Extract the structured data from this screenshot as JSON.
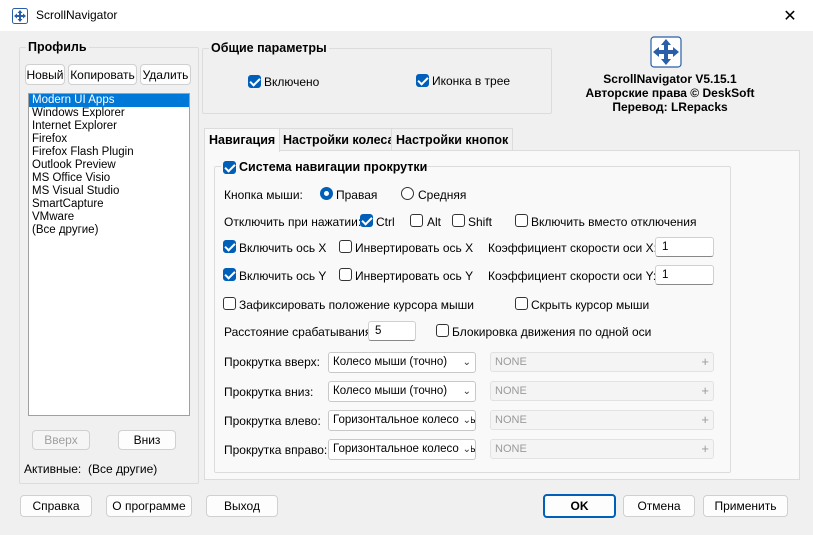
{
  "window": {
    "title": "ScrollNavigator"
  },
  "profile": {
    "group_title": "Профиль",
    "new_label": "Новый",
    "copy_label": "Копировать",
    "delete_label": "Удалить",
    "items": [
      "Modern UI Apps",
      "Windows Explorer",
      "Internet Explorer",
      "Firefox",
      "Firefox Flash Plugin",
      "Outlook Preview",
      "MS Office Visio",
      "MS Visual Studio",
      "SmartCapture",
      "VMware",
      "(Все другие)"
    ],
    "selected_index": 0,
    "up_label": "Вверх",
    "down_label": "Вниз",
    "active_label": "Активные:",
    "active_value": "(Все другие)"
  },
  "general": {
    "group_title": "Общие параметры",
    "enabled_label": "Включено",
    "enabled_checked": true,
    "tray_label": "Иконка в трее",
    "tray_checked": true
  },
  "about": {
    "line1": "ScrollNavigator V5.15.1",
    "line2": "Авторские права © DeskSoft",
    "line3": "Перевод: LRepacks"
  },
  "tabs": [
    "Навигация",
    "Настройки колеса",
    "Настройки кнопок"
  ],
  "active_tab": 0,
  "navigation": {
    "system_label": "Система навигации прокрутки",
    "system_checked": true,
    "mouse_button_label": "Кнопка мыши:",
    "radio_middle_label": "Средняя",
    "radio_right_label": "Правая",
    "selected_button": "Правая",
    "disable_on_press_label": "Отключить при нажатии:",
    "ctrl_label": "Ctrl",
    "ctrl_checked": true,
    "alt_label": "Alt",
    "alt_checked": false,
    "shift_label": "Shift",
    "shift_checked": false,
    "enable_instead_label": "Включить вместо отключения",
    "enable_instead_checked": false,
    "axis_x_label": "Включить ось X",
    "axis_x_checked": true,
    "invert_x_label": "Инвертировать ось X",
    "invert_x_checked": false,
    "speed_x_label": "Коэффициент скорости оси X:",
    "speed_x_value": "1",
    "axis_y_label": "Включить ось Y",
    "axis_y_checked": true,
    "invert_y_label": "Инвертировать ось Y",
    "invert_y_checked": false,
    "speed_y_label": "Коэффициент скорости оси Y:",
    "speed_y_value": "1",
    "fix_cursor_label": "Зафиксировать положение курсора мыши",
    "fix_cursor_checked": false,
    "hide_cursor_label": "Скрыть курсор мыши",
    "hide_cursor_checked": false,
    "distance_label": "Расстояние срабатывания:",
    "distance_value": "5",
    "lock_axis_label": "Блокировка движения по одной оси",
    "lock_axis_checked": false,
    "scroll_rows": [
      {
        "label": "Прокрутка вверх:",
        "value": "Колесо мыши (точно)",
        "shortcut": "NONE"
      },
      {
        "label": "Прокрутка вниз:",
        "value": "Колесо мыши (точно)",
        "shortcut": "NONE"
      },
      {
        "label": "Прокрутка влево:",
        "value": "Горизонтальное колесо мыши",
        "shortcut": "NONE"
      },
      {
        "label": "Прокрутка вправо:",
        "value": "Горизонтальное колесо мыши",
        "shortcut": "NONE"
      }
    ]
  },
  "footer": {
    "help_label": "Справка",
    "about_label": "О программе",
    "exit_label": "Выход",
    "ok_label": "OK",
    "cancel_label": "Отмена",
    "apply_label": "Применить"
  },
  "colors": {
    "accent": "#005fb8",
    "selection": "#0078d7"
  }
}
